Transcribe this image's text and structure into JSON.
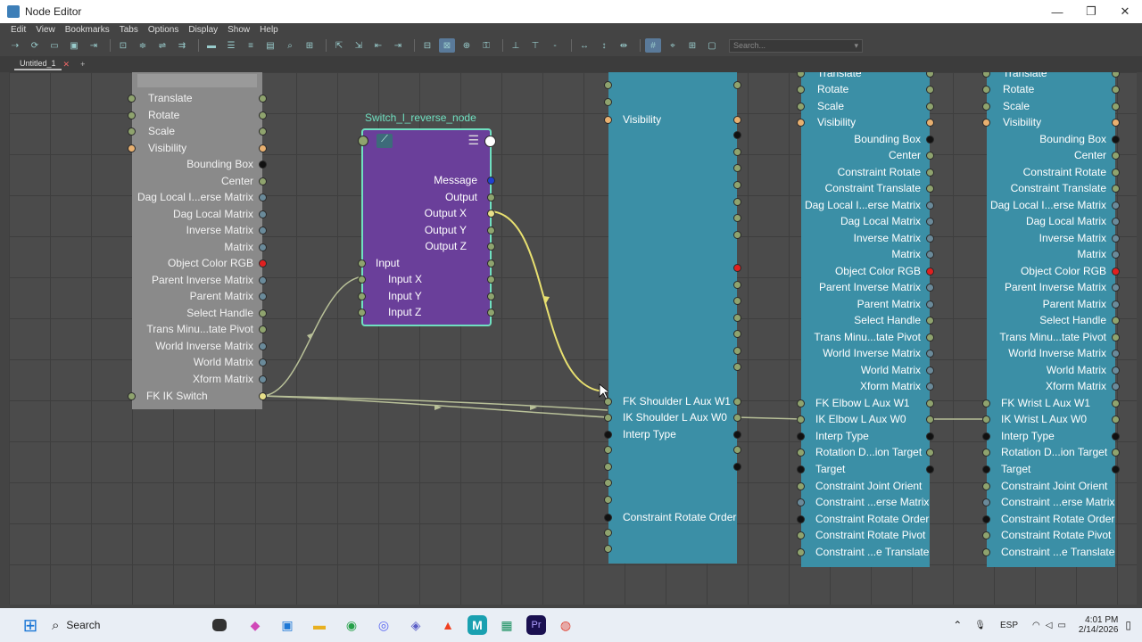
{
  "window": {
    "title": "Node Editor",
    "buttons": [
      "—",
      "❐",
      "✕"
    ]
  },
  "menu": [
    "Edit",
    "View",
    "Bookmarks",
    "Tabs",
    "Options",
    "Display",
    "Show",
    "Help"
  ],
  "search": {
    "placeholder": "Search..."
  },
  "tabs": [
    {
      "label": "Untitled_1"
    }
  ],
  "nodes": {
    "left": {
      "rows": [
        "Translate",
        "Rotate",
        "Scale",
        "Visibility",
        "Bounding Box",
        "Center",
        "Dag Local I...erse Matrix",
        "Dag Local Matrix",
        "Inverse Matrix",
        "Matrix",
        "Object Color RGB",
        "Parent Inverse Matrix",
        "Parent Matrix",
        "Select Handle",
        "Trans Minu...tate Pivot",
        "World Inverse Matrix",
        "World Matrix",
        "Xform Matrix",
        "FK IK Switch"
      ]
    },
    "switch": {
      "title": "Switch_l_reverse_node",
      "rows": [
        "Message",
        "Output",
        "Output X",
        "Output Y",
        "Output Z",
        "Input",
        "Input X",
        "Input Y",
        "Input Z"
      ]
    },
    "shoulder": {
      "rows": [
        "Visibility",
        "FK Shoulder L Aux W1",
        "IK Shoulder L Aux W0",
        "Interp Type",
        "Constraint Rotate Order"
      ]
    },
    "elbow": {
      "rows": [
        "Translate",
        "Rotate",
        "Scale",
        "Visibility",
        "Bounding Box",
        "Center",
        "Constraint Rotate",
        "Constraint Translate",
        "Dag Local I...erse Matrix",
        "Dag Local Matrix",
        "Inverse Matrix",
        "Matrix",
        "Object Color RGB",
        "Parent Inverse Matrix",
        "Parent Matrix",
        "Select Handle",
        "Trans Minu...tate Pivot",
        "World Inverse Matrix",
        "World Matrix",
        "Xform Matrix",
        "FK Elbow L Aux W1",
        "IK Elbow L Aux W0",
        "Interp Type",
        "Rotation D...ion Target",
        "Target",
        "Constraint Joint Orient",
        "Constraint ...erse Matrix",
        "Constraint Rotate Order",
        "Constraint Rotate Pivot",
        "Constraint ...e Translate"
      ]
    },
    "wrist": {
      "rows": [
        "Translate",
        "Rotate",
        "Scale",
        "Visibility",
        "Bounding Box",
        "Center",
        "Constraint Rotate",
        "Constraint Translate",
        "Dag Local I...erse Matrix",
        "Dag Local Matrix",
        "Inverse Matrix",
        "Matrix",
        "Object Color RGB",
        "Parent Inverse Matrix",
        "Parent Matrix",
        "Select Handle",
        "Trans Minu...tate Pivot",
        "World Inverse Matrix",
        "World Matrix",
        "Xform Matrix",
        "FK Wrist L Aux W1",
        "IK Wrist L Aux W0",
        "Interp Type",
        "Rotation D...ion Target",
        "Target",
        "Constraint Joint Orient",
        "Constraint ...erse Matrix",
        "Constraint Rotate Order",
        "Constraint Rotate Pivot",
        "Constraint ...e Translate"
      ]
    }
  },
  "taskbar": {
    "search": "Search",
    "lang": "ESP",
    "time": "4:01 PM",
    "date": "2/14/2026"
  },
  "colors": {
    "canvas": "#4b4b4b",
    "grey_node": "#8a8a8a",
    "purple_node": "#6a3f9a",
    "teal_node": "#3b8fa6",
    "connection": "#e8e070",
    "edge": "#c8d0a0"
  }
}
